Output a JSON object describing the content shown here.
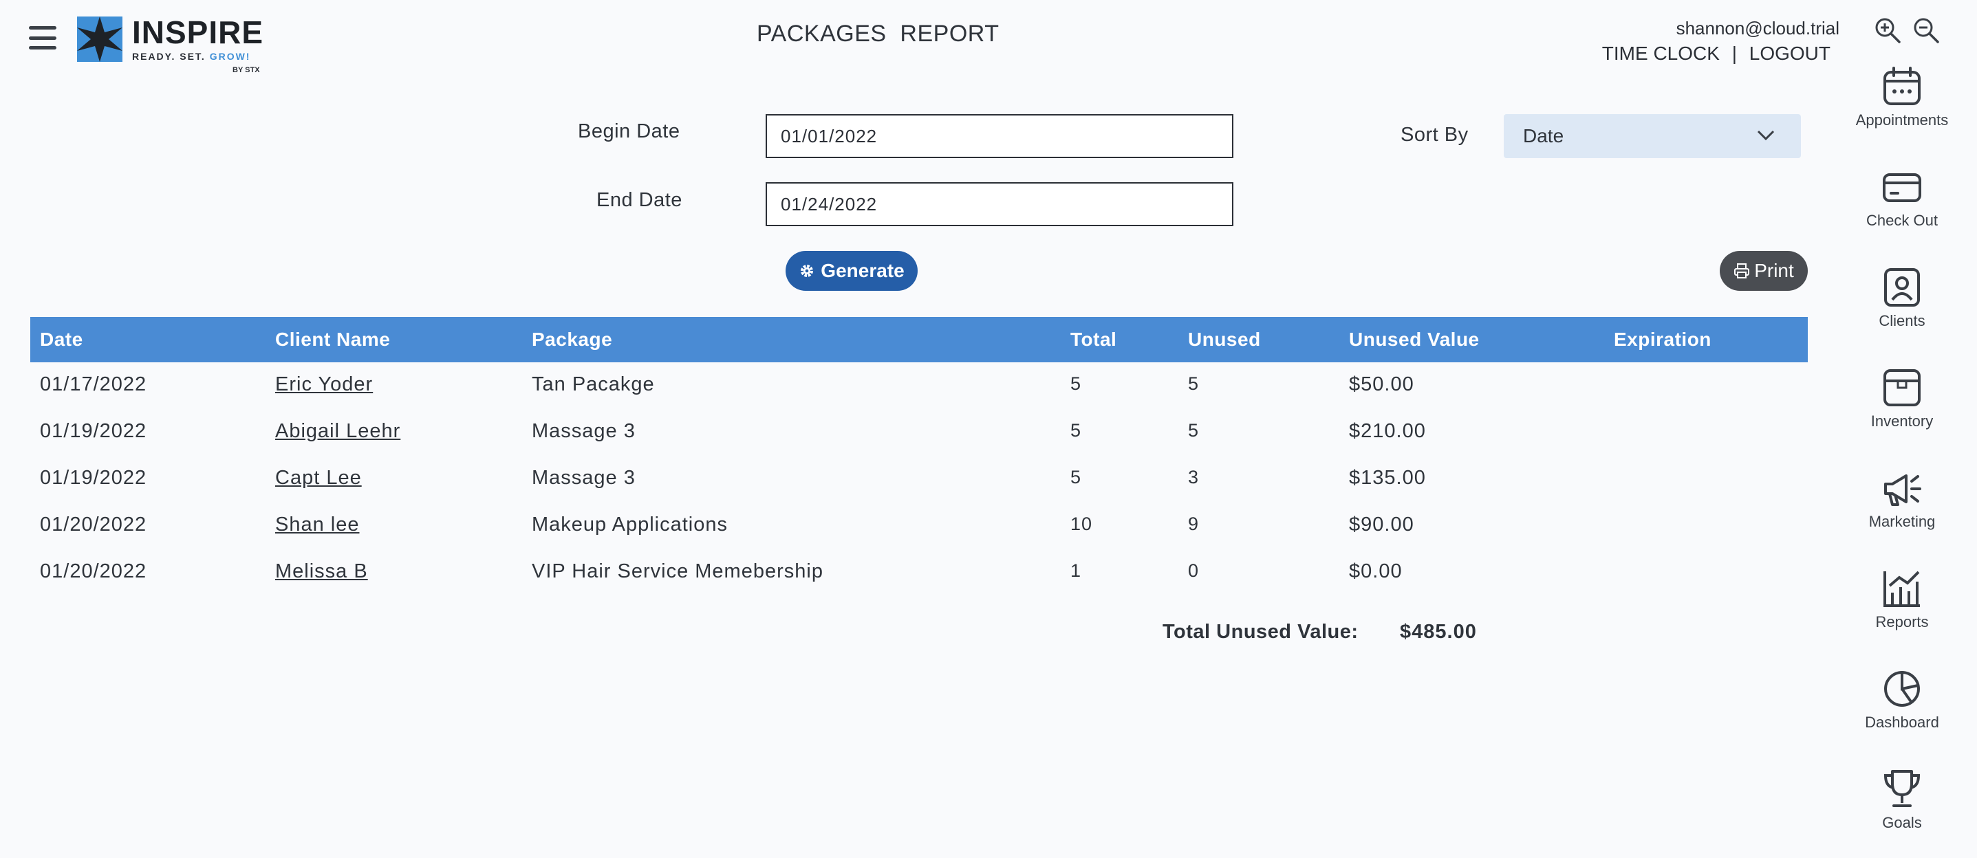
{
  "app": {
    "logo_title": "INSPIRE",
    "logo_tagline_prefix": "READY. SET. ",
    "logo_tagline_accent": "GROW!",
    "logo_by": "BY STX",
    "page_title": "PACKAGES  REPORT"
  },
  "user": {
    "email": "shannon@cloud.trial",
    "time_clock": "TIME CLOCK",
    "separator": "|",
    "logout": "LOGOUT"
  },
  "form": {
    "begin_label": "Begin Date",
    "begin_value": "01/01/2022",
    "end_label": "End Date",
    "end_value": "01/24/2022",
    "sort_label": "Sort By",
    "sort_value": "Date",
    "generate_label": "Generate",
    "print_label": "Print"
  },
  "table": {
    "headers": [
      "Date",
      "Client Name",
      "Package",
      "Total",
      "Unused",
      "Unused Value",
      "Expiration"
    ],
    "rows": [
      {
        "date": "01/17/2022",
        "client": "Eric Yoder",
        "package": "Tan Pacakge",
        "total": "5",
        "unused": "5",
        "value": "$50.00",
        "expiration": ""
      },
      {
        "date": "01/19/2022",
        "client": "Abigail Leehr",
        "package": "Massage 3",
        "total": "5",
        "unused": "5",
        "value": "$210.00",
        "expiration": ""
      },
      {
        "date": "01/19/2022",
        "client": "Capt Lee",
        "package": "Massage 3",
        "total": "5",
        "unused": "3",
        "value": "$135.00",
        "expiration": ""
      },
      {
        "date": "01/20/2022",
        "client": "Shan lee",
        "package": "Makeup Applications",
        "total": "10",
        "unused": "9",
        "value": "$90.00",
        "expiration": ""
      },
      {
        "date": "01/20/2022",
        "client": "Melissa B",
        "package": "VIP Hair Service Memebership",
        "total": "1",
        "unused": "0",
        "value": "$0.00",
        "expiration": ""
      }
    ],
    "total_label": "Total Unused Value:",
    "total_value": "$485.00"
  },
  "nav": {
    "items": [
      {
        "label": "Appointments",
        "icon": "calendar-icon"
      },
      {
        "label": "Check Out",
        "icon": "credit-card-icon"
      },
      {
        "label": "Clients",
        "icon": "client-icon"
      },
      {
        "label": "Inventory",
        "icon": "box-icon"
      },
      {
        "label": "Marketing",
        "icon": "megaphone-icon"
      },
      {
        "label": "Reports",
        "icon": "chart-icon"
      },
      {
        "label": "Dashboard",
        "icon": "pie-chart-icon"
      },
      {
        "label": "Goals",
        "icon": "trophy-icon"
      }
    ]
  },
  "colors": {
    "header_blue": "#4a8bd4",
    "generate_blue": "#255ea8",
    "print_gray": "#4a4d52",
    "select_bg": "#dde8f5",
    "logo_blue": "#3f8fd6"
  }
}
